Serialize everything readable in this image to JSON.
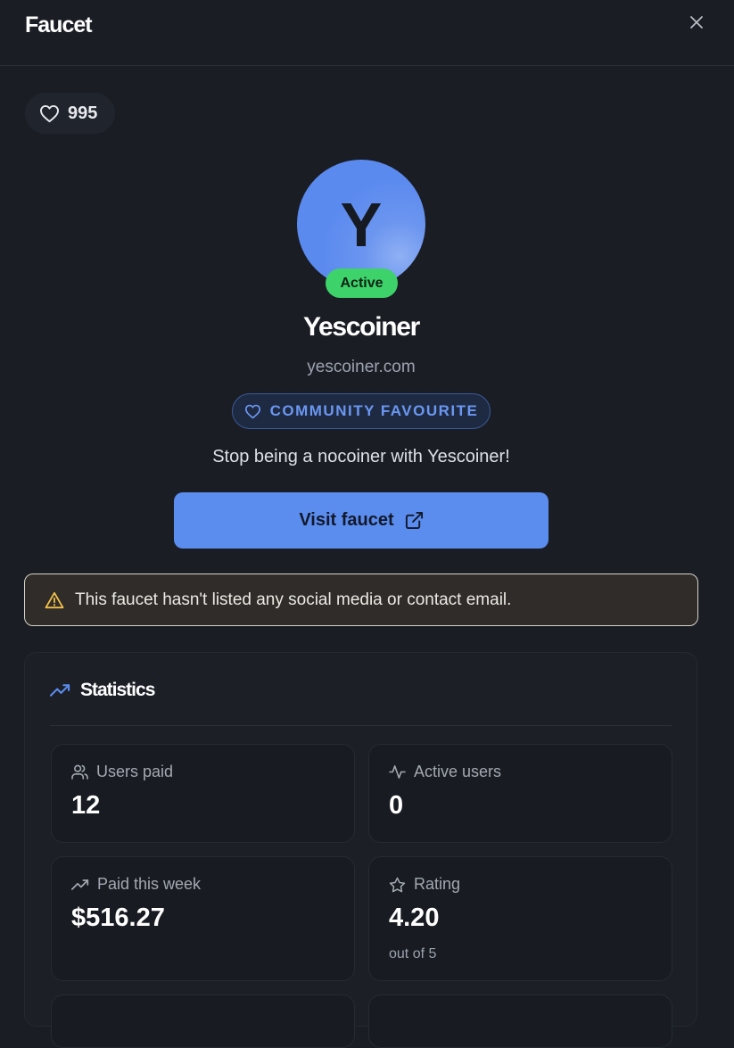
{
  "header": {
    "title": "Faucet",
    "close_icon": "close-icon"
  },
  "likes": {
    "count": "995",
    "icon": "heart-icon"
  },
  "faucet": {
    "avatar_letter": "Y",
    "status": "Active",
    "name": "Yescoiner",
    "domain": "yescoiner.com",
    "badge": "COMMUNITY FAVOURITE",
    "tagline": "Stop being a nocoiner with Yescoiner!",
    "visit_label": "Visit faucet"
  },
  "warning": {
    "text": "This faucet hasn't listed any social media or contact email.",
    "icon": "warning-icon"
  },
  "statistics": {
    "title": "Statistics",
    "tiles": [
      {
        "label": "Users paid",
        "value": "12",
        "icon": "users-icon"
      },
      {
        "label": "Active users",
        "value": "0",
        "icon": "activity-icon"
      },
      {
        "label": "Paid this week",
        "value": "$516.27",
        "icon": "trending-up-icon"
      },
      {
        "label": "Rating",
        "value": "4.20",
        "sub": "out of 5",
        "icon": "star-icon"
      }
    ]
  },
  "colors": {
    "background": "#1a1d24",
    "accent": "#5b8def",
    "active_green": "#3dd36a",
    "warning_yellow": "#f2c04a"
  }
}
